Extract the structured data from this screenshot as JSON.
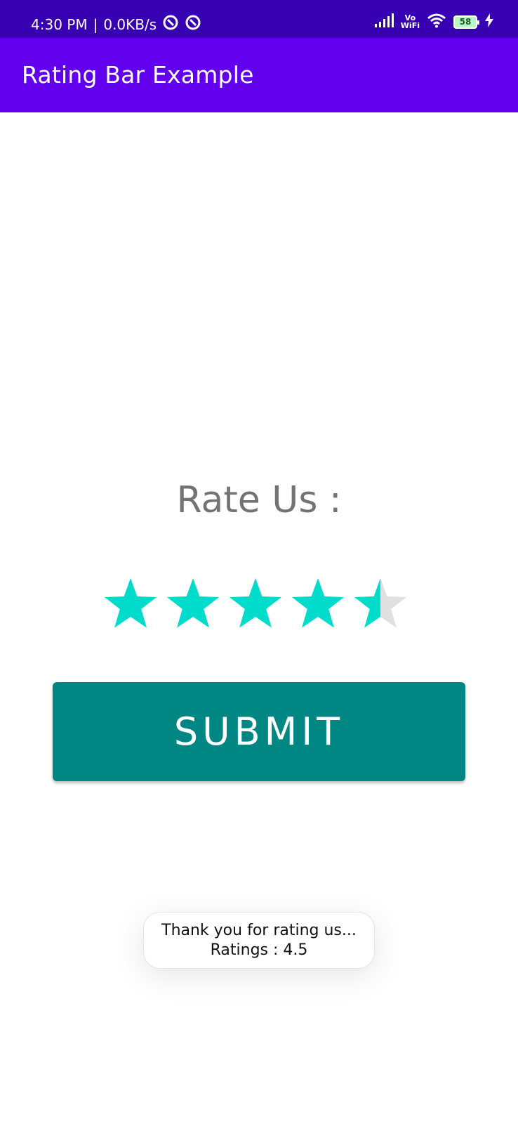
{
  "status_bar": {
    "time": "4:30 PM",
    "separator": "|",
    "speed": "0.0KB/s",
    "vo": "Vo",
    "wifi": "WiFi",
    "battery": "58",
    "icons": [
      "sync-icon",
      "sync-icon",
      "signal-icon",
      "vowifi-icon",
      "wifi-icon",
      "battery-icon",
      "charging-bolt-icon"
    ]
  },
  "app_bar": {
    "title": "Rating Bar Example",
    "color": "#6200ee"
  },
  "main": {
    "rate_label": "Rate Us :",
    "rating": {
      "value": 4.5,
      "max": 5,
      "filled_color": "#00dccb",
      "empty_color": "#e0e0e0"
    },
    "submit_label": "SUBMIT",
    "submit_color": "#008783"
  },
  "toast": {
    "line1": "Thank you for rating us...",
    "line2": "Ratings : 4.5"
  }
}
